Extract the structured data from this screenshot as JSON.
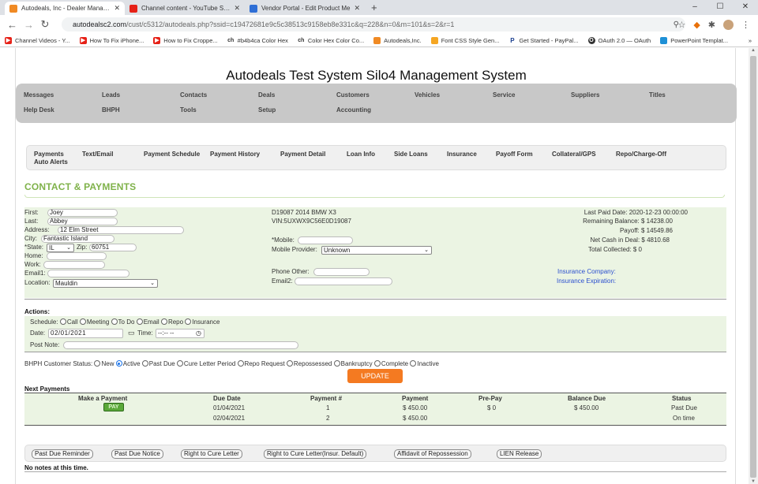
{
  "browser": {
    "tabs": [
      {
        "title": "Autodeals, Inc - Dealer Managem",
        "color": "#f08a24"
      },
      {
        "title": "Channel content - YouTube Studi",
        "color": "#e62117"
      },
      {
        "title": "Vendor Portal - Edit Product Me",
        "color": "#2f6fd6"
      }
    ],
    "new_tab": "+",
    "window_controls": [
      "–",
      "☐",
      "✕"
    ],
    "url_host": "autodealsc2.com",
    "url_path": "/cust/c5312/autodeals.php?ssid=c19472681e9c5c38513c9158eb8e331c&q=228&n=0&m=101&s=2&r=1",
    "bookmarks": [
      {
        "label": "Channel Videos - Y...",
        "color": "#e62117",
        "glyph": "▶"
      },
      {
        "label": "How To Fix iPhone...",
        "color": "#e62117",
        "glyph": "▶"
      },
      {
        "label": "How to Fix Croppe...",
        "color": "#e62117",
        "glyph": "▶"
      },
      {
        "label": "#b4b4ca Color Hex",
        "color": "#ffffff",
        "glyph": "ch"
      },
      {
        "label": "Color Hex Color Co...",
        "color": "#ffffff",
        "glyph": "ch"
      },
      {
        "label": "Autodeals,Inc.",
        "color": "#f08a24",
        "glyph": "A"
      },
      {
        "label": "Font CSS Style Gen...",
        "color": "#f5a623",
        "glyph": "F"
      },
      {
        "label": "Get Started - PayPal...",
        "color": "#ffffff",
        "glyph": "P"
      },
      {
        "label": "OAuth 2.0 — OAuth",
        "color": "#333333",
        "glyph": "O"
      },
      {
        "label": "PowerPoint Templat...",
        "color": "#1e90d6",
        "glyph": "P"
      }
    ],
    "bookmarks_more": "»"
  },
  "page": {
    "site_title": "Autodeals Test System Silo4 Management System",
    "menu_row1": [
      "Messages",
      "Leads",
      "Contacts",
      "Deals",
      "Customers",
      "Vehicles",
      "Service",
      "Suppliers",
      "Titles"
    ],
    "menu_row2": [
      "Help Desk",
      "BHPH",
      "Tools",
      "Setup",
      "Accounting"
    ],
    "subtabs": [
      "Payments",
      "Text/Email",
      "Payment Schedule",
      "Payment History",
      "Payment Detail",
      "Loan Info",
      "Side Loans",
      "Insurance",
      "Payoff Form",
      "Collateral/GPS",
      "Repo/Charge-Off"
    ],
    "subtab_row2": "Auto Alerts",
    "section_title": "CONTACT & PAYMENTS"
  },
  "contact": {
    "first_label": "First:",
    "first": "Joey",
    "last_label": "Last:",
    "last": "Abbey",
    "address_label": "Address:",
    "address": "12 Elm Street",
    "city_label": "City:",
    "city": "Fantastic Island",
    "state_label": "*State:",
    "state": "IL",
    "zip_label": "Zip:",
    "zip": "60751",
    "home_label": "Home:",
    "home": "",
    "work_label": "Work:",
    "work": "",
    "email1_label": "Email1:",
    "email1": "",
    "location_label": "Location:",
    "location": "Mauldin",
    "vehicle": "D19087 2014 BMW X3",
    "vin": "VIN:5UXWX9C56E0D19087",
    "mobile_label": "*Mobile:",
    "mobile": "",
    "provider_label": "Mobile Provider:",
    "provider": "Unknown",
    "phone_other_label": "Phone Other:",
    "phone_other": "",
    "email2_label": "Email2:",
    "email2": "",
    "last_paid": "Last Paid Date: 2020-12-23 00:00:00",
    "remaining": "Remaining Balance: $ 14238.00",
    "payoff": "Payoff: $ 14549.86",
    "net_cash": "Net Cash in Deal: $ 4810.68",
    "total_collected": "Total Collected: $ 0",
    "insurance_company": "Insurance Company:",
    "insurance_expiration": "Insurance Expiration:"
  },
  "actions": {
    "title": "Actions:",
    "schedule_label": "Schedule:",
    "schedule_options": [
      "Call",
      "Meeting",
      "To Do",
      "Email",
      "Repo",
      "Insurance"
    ],
    "date_label": "Date:",
    "date": "02/01/2021",
    "time_label": "Time:",
    "time": "--:-- --",
    "post_note_label": "Post Note:"
  },
  "status": {
    "label": "BHPH Customer Status:",
    "options": [
      "New",
      "Active",
      "Past Due",
      "Cure Letter Period",
      "Repo Request",
      "Repossessed",
      "Bankruptcy",
      "Complete",
      "Inactive"
    ],
    "selected": "Active",
    "update_button": "UPDATE"
  },
  "payments": {
    "title": "Next Payments",
    "headers": [
      "Make a Payment",
      "Due Date",
      "Payment #",
      "Payment",
      "Pre-Pay",
      "Balance Due",
      "Status"
    ],
    "pay_button": "PAY",
    "rows": [
      {
        "due": "01/04/2021",
        "num": "1",
        "payment": "$ 450.00",
        "prepay": "$ 0",
        "balance": "$ 450.00",
        "status": "Past Due"
      },
      {
        "due": "02/04/2021",
        "num": "2",
        "payment": "$ 450.00",
        "prepay": "",
        "balance": "",
        "status": "On time"
      }
    ]
  },
  "bottom_buttons": [
    "Past Due Reminder",
    "Past Due Notice",
    "Right to Cure Letter",
    "Right to Cure Letter(Insur. Default)",
    "Affidavit of Repossession",
    "LIEN Release"
  ],
  "notes": "No notes at this time."
}
